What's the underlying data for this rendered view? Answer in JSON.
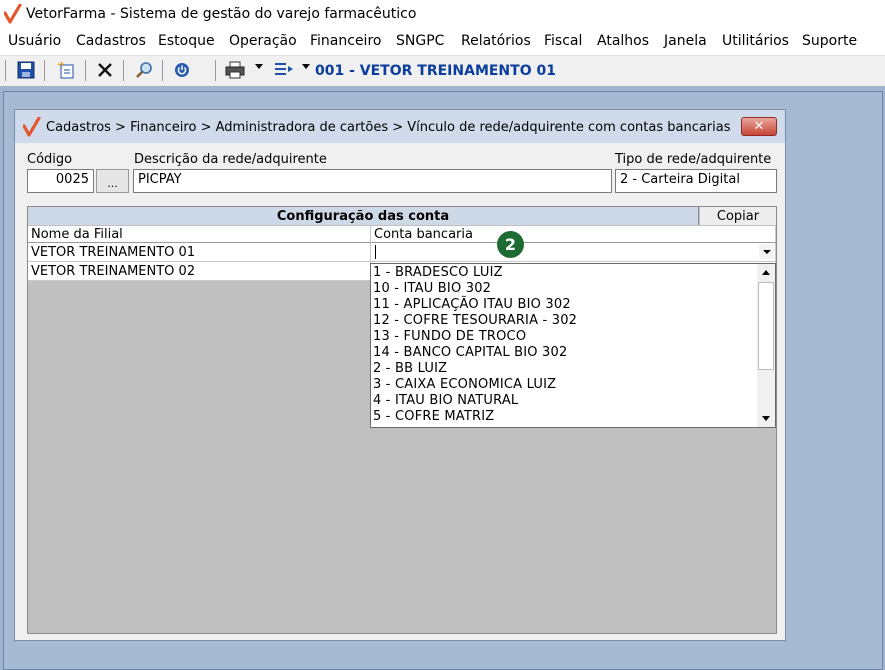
{
  "app": {
    "title": "VetorFarma - Sistema de gestão do varejo farmacêutico",
    "brand_color": "#e4572e"
  },
  "menu": [
    "Usuário",
    "Cadastros",
    "Estoque",
    "Operação",
    "Financeiro",
    "SNGPC",
    "Relatórios",
    "Fiscal",
    "Atalhos",
    "Janela",
    "Utilitários",
    "Suporte"
  ],
  "toolbar": {
    "icons": [
      "save-icon",
      "new-document-icon",
      "delete-icon",
      "search-icon",
      "power-icon",
      "print-icon",
      "list-icon"
    ],
    "company": "001 - VETOR TREINAMENTO 01",
    "company_color": "#0a3d9e"
  },
  "dialog": {
    "title": "Cadastros > Financeiro > Administradora de cartões > Vínculo de rede/adquirente com contas bancarias",
    "close_label": "✕",
    "codigo_label": "Código",
    "codigo_value": "0025",
    "lookup_label": "...",
    "descricao_label": "Descrição da rede/adquirente",
    "descricao_value": "PICPAY",
    "tipo_label": "Tipo de rede/adquirente",
    "tipo_value": "2 - Carteira Digital"
  },
  "grid": {
    "caption": "Configuração das conta",
    "copy_label": "Copiar",
    "columns": [
      "Nome da Filial",
      "Conta bancaria"
    ],
    "rows": [
      {
        "filial": "VETOR TREINAMENTO 01",
        "conta": ""
      },
      {
        "filial": "VETOR TREINAMENTO 02",
        "conta": ""
      }
    ]
  },
  "step_badge": "2",
  "dropdown": {
    "options": [
      "1 - BRADESCO LUIZ",
      "10 - ITAU BIO 302",
      "11 - APLICAÇÃO ITAU BIO 302",
      "12 - COFRE TESOURARIA - 302",
      "13 - FUNDO DE TROCO",
      "14 - BANCO CAPITAL BIO 302",
      "2 - BB LUIZ",
      "3 - CAIXA ECONOMICA LUIZ",
      "4 - ITAU BIO NATURAL",
      "5 - COFRE MATRIZ"
    ]
  }
}
